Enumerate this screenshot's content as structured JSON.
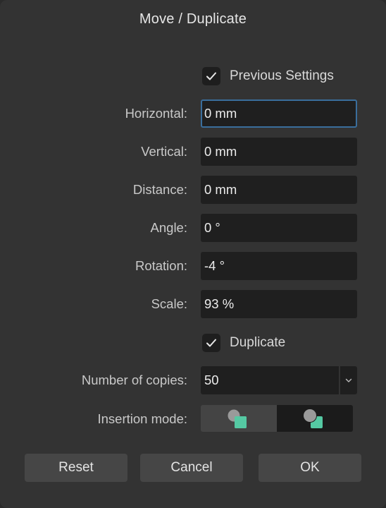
{
  "dialog": {
    "title": "Move / Duplicate",
    "previous_settings": {
      "label": "Previous Settings",
      "checked": true
    },
    "fields": [
      {
        "label": "Horizontal:",
        "value": "0 mm"
      },
      {
        "label": "Vertical:",
        "value": "0 mm"
      },
      {
        "label": "Distance:",
        "value": "0 mm"
      },
      {
        "label": "Angle:",
        "value": "0 °"
      },
      {
        "label": "Rotation:",
        "value": "-4 °"
      },
      {
        "label": "Scale:",
        "value": "93 %"
      }
    ],
    "duplicate": {
      "label": "Duplicate",
      "checked": true
    },
    "copies": {
      "label": "Number of copies:",
      "value": "50"
    },
    "insertion_mode": {
      "label": "Insertion mode:",
      "options": [
        "insert-behind-icon",
        "insert-in-front-icon"
      ],
      "selected_index": 1
    },
    "buttons": {
      "reset": "Reset",
      "cancel": "Cancel",
      "ok": "OK"
    }
  },
  "colors": {
    "dialog_bg": "#333333",
    "field_bg": "#1f1f1f",
    "button_bg": "#464646",
    "focus_border": "#3a6e9c",
    "shape_teal": "#55c9a3",
    "shape_gray": "#9a9a9a"
  }
}
